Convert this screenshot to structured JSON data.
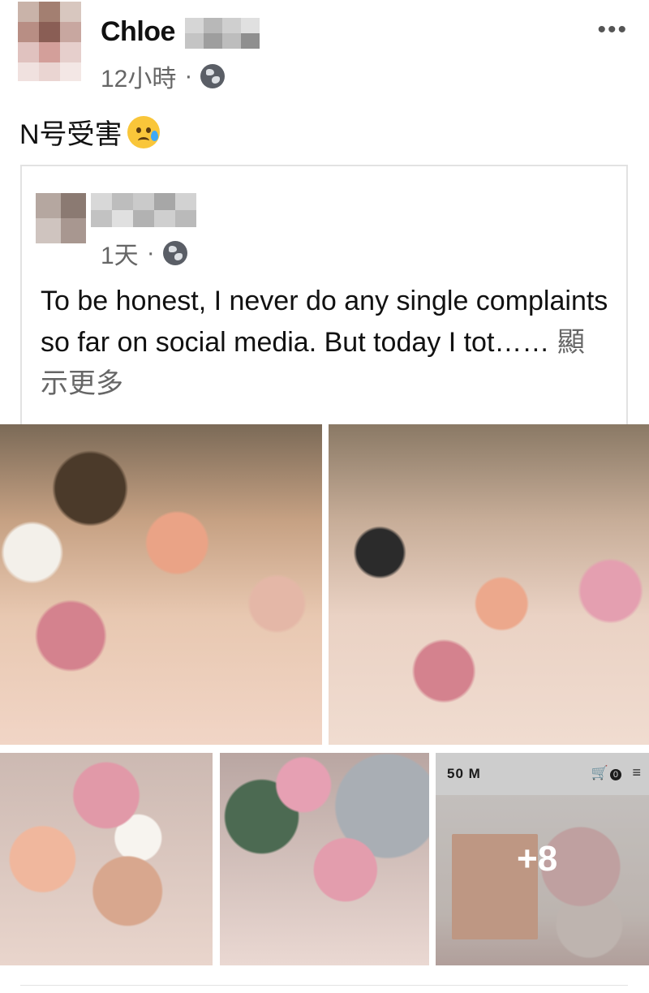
{
  "post": {
    "author_name": "Chloe",
    "time": "12小時",
    "separator": "·",
    "text": "N号受害",
    "more_label": "•••"
  },
  "shared_post": {
    "time": "1天",
    "separator": "·",
    "text": "To be honest, I never do any single complaints so far on social media. But today I tot……",
    "see_more": "顯示更多"
  },
  "photos": {
    "store_logo": "50   M",
    "cart_count": "0",
    "more_count": "+8"
  },
  "colors": {
    "text": "#111111",
    "meta": "#666666",
    "border": "#e2e2e2"
  },
  "icons": [
    "globe-icon",
    "more-options-icon",
    "crying-face-emoji",
    "cart-icon",
    "menu-icon"
  ]
}
